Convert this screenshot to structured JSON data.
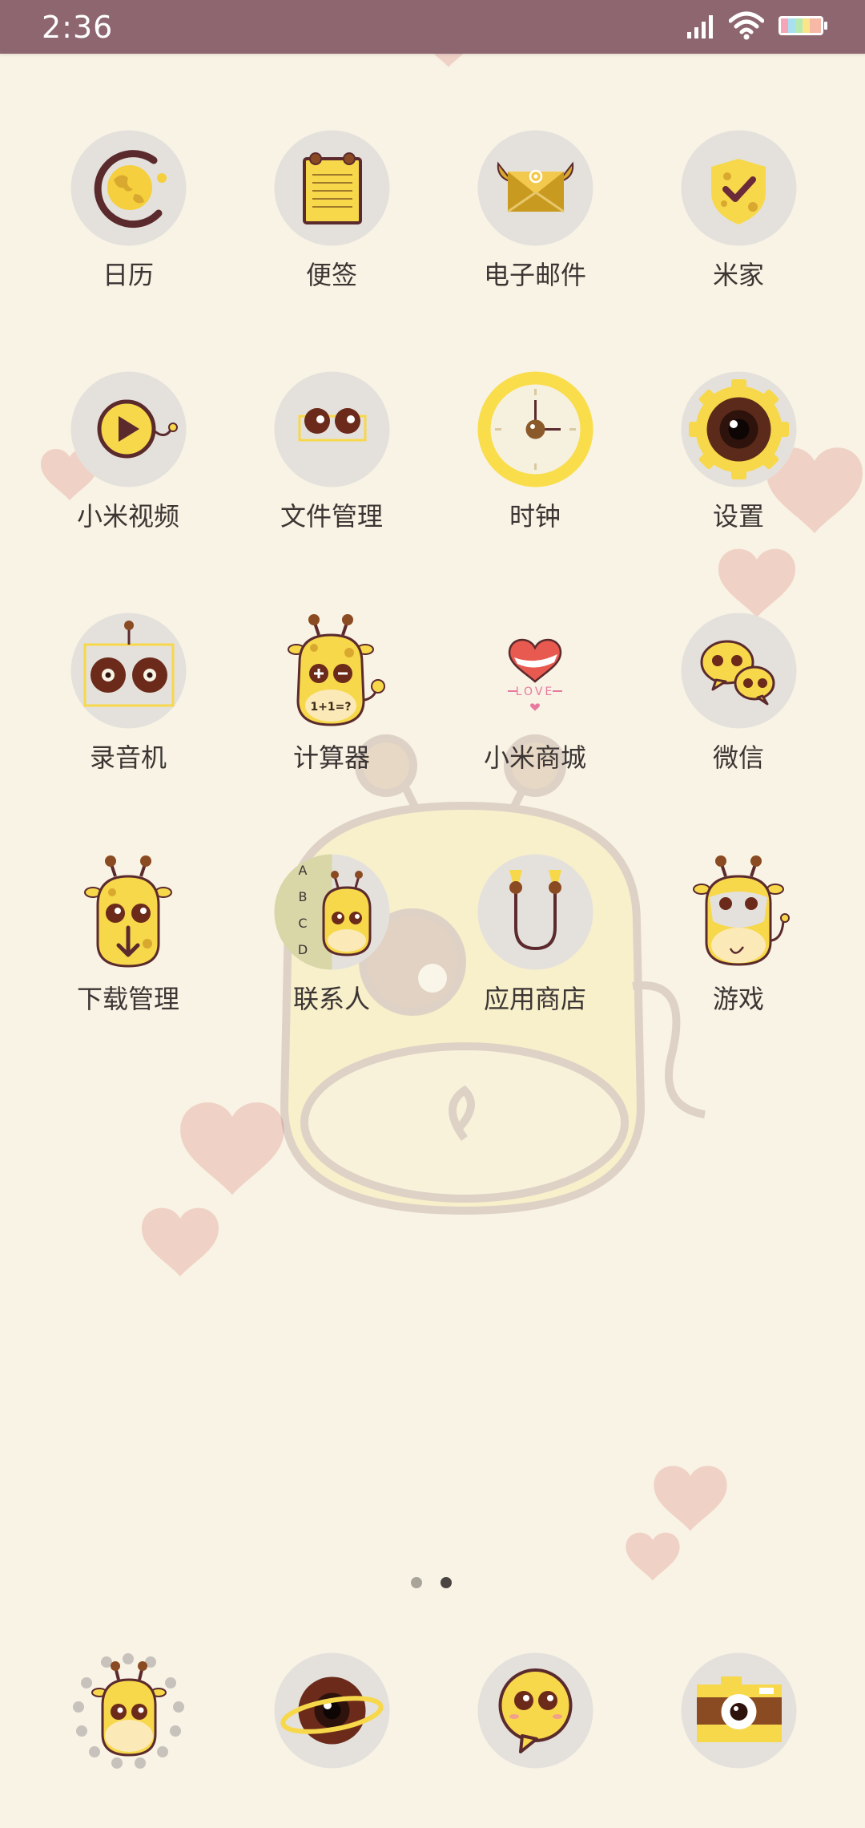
{
  "status_bar": {
    "time": "2:36",
    "signal_icon": "signal-icon",
    "wifi_icon": "wifi-icon",
    "battery_icon": "battery-icon"
  },
  "apps": [
    {
      "label": "日历",
      "icon": "calendar-icon"
    },
    {
      "label": "便签",
      "icon": "notes-icon"
    },
    {
      "label": "电子邮件",
      "icon": "email-icon"
    },
    {
      "label": "米家",
      "icon": "mi-home-icon"
    },
    {
      "label": "小米视频",
      "icon": "mi-video-icon"
    },
    {
      "label": "文件管理",
      "icon": "file-manager-icon"
    },
    {
      "label": "时钟",
      "icon": "clock-icon"
    },
    {
      "label": "设置",
      "icon": "settings-icon"
    },
    {
      "label": "录音机",
      "icon": "recorder-icon"
    },
    {
      "label": "计算器",
      "icon": "calculator-icon",
      "icon_text": "1+1=?"
    },
    {
      "label": "小米商城",
      "icon": "mi-store-icon",
      "icon_text": "LOVE"
    },
    {
      "label": "微信",
      "icon": "wechat-icon"
    },
    {
      "label": "下载管理",
      "icon": "downloads-icon"
    },
    {
      "label": "联系人",
      "icon": "contacts-icon",
      "icon_index": [
        "A",
        "B",
        "C",
        "D"
      ]
    },
    {
      "label": "应用商店",
      "icon": "app-store-icon"
    },
    {
      "label": "游戏",
      "icon": "games-icon"
    }
  ],
  "dock": [
    {
      "icon": "phone-icon"
    },
    {
      "icon": "browser-icon"
    },
    {
      "icon": "messages-icon"
    },
    {
      "icon": "camera-icon"
    }
  ],
  "pager": {
    "page_count": 2,
    "current_page": 2
  },
  "colors": {
    "status_bar": "#8d6670",
    "background": "#f8f3e4",
    "accent_yellow": "#f7d84a",
    "outline_brown": "#5b2a2d",
    "icon_circle": "#e4e1dd",
    "label": "#3b3534",
    "heart_pink": "#e9b5ad"
  }
}
